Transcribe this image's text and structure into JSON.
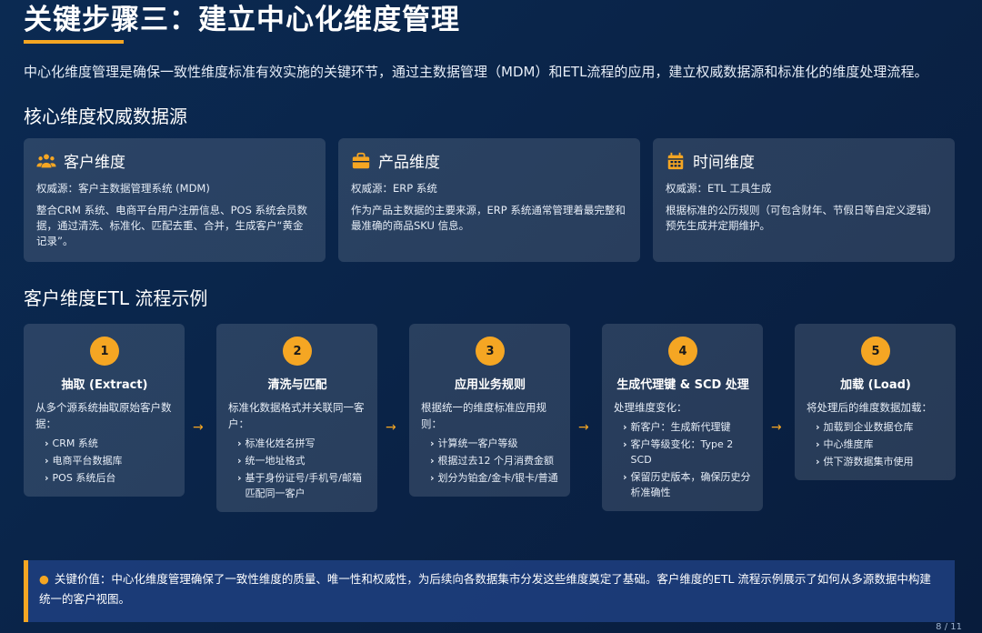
{
  "title": "关键步骤三：建立中心化维度管理",
  "intro": "中心化维度管理是确保一致性维度标准有效实施的关键环节，通过主数据管理（MDM）和ETL流程的应用，建立权威数据源和标准化的维度处理流程。",
  "section1_title": "核心维度权威数据源",
  "cards": [
    {
      "icon": "users-icon",
      "title": "客户维度",
      "source": "权威源：客户主数据管理系统 (MDM)",
      "desc": "整合CRM 系统、电商平台用户注册信息、POS 系统会员数据，通过清洗、标准化、匹配去重、合并，生成客户“黄金记录”。"
    },
    {
      "icon": "briefcase-icon",
      "title": "产品维度",
      "source": "权威源：ERP 系统",
      "desc": "作为产品主数据的主要来源，ERP 系统通常管理着最完整和最准确的商品SKU 信息。"
    },
    {
      "icon": "calendar-icon",
      "title": "时间维度",
      "source": "权威源：ETL 工具生成",
      "desc": "根据标准的公历规则（可包含财年、节假日等自定义逻辑）预先生成并定期维护。"
    }
  ],
  "section2_title": "客户维度ETL 流程示例",
  "steps": [
    {
      "num": "1",
      "title": "抽取 (Extract)",
      "desc": "从多个源系统抽取原始客户数据：",
      "items": [
        "CRM 系统",
        "电商平台数据库",
        "POS 系统后台"
      ]
    },
    {
      "num": "2",
      "title": "清洗与匹配",
      "desc": "标准化数据格式并关联同一客户：",
      "items": [
        "标准化姓名拼写",
        "统一地址格式",
        "基于身份证号/手机号/邮箱匹配同一客户"
      ]
    },
    {
      "num": "3",
      "title": "应用业务规则",
      "desc": "根据统一的维度标准应用规则：",
      "items": [
        "计算统一客户等级",
        "根据过去12 个月消费金额",
        "划分为铂金/金卡/银卡/普通"
      ]
    },
    {
      "num": "4",
      "title": "生成代理键 & SCD 处理",
      "desc": "处理维度变化：",
      "items": [
        "新客户：生成新代理键",
        "客户等级变化：Type 2 SCD",
        "保留历史版本，确保历史分析准确性"
      ]
    },
    {
      "num": "5",
      "title": "加载 (Load)",
      "desc": "将处理后的维度数据加载：",
      "items": [
        "加载到企业数据仓库",
        "中心维度库",
        "供下游数据集市使用"
      ]
    }
  ],
  "arrow_glyph": "→",
  "callout": "关键价值：中心化维度管理确保了一致性维度的质量、唯一性和权威性，为后续向各数据集市分发这些维度奠定了基础。客户维度的ETL 流程示例展示了如何从多源数据中构建统一的客户视图。",
  "page": "8 / 11",
  "colors": {
    "accent": "#f5a623",
    "background": "#0a2347"
  }
}
